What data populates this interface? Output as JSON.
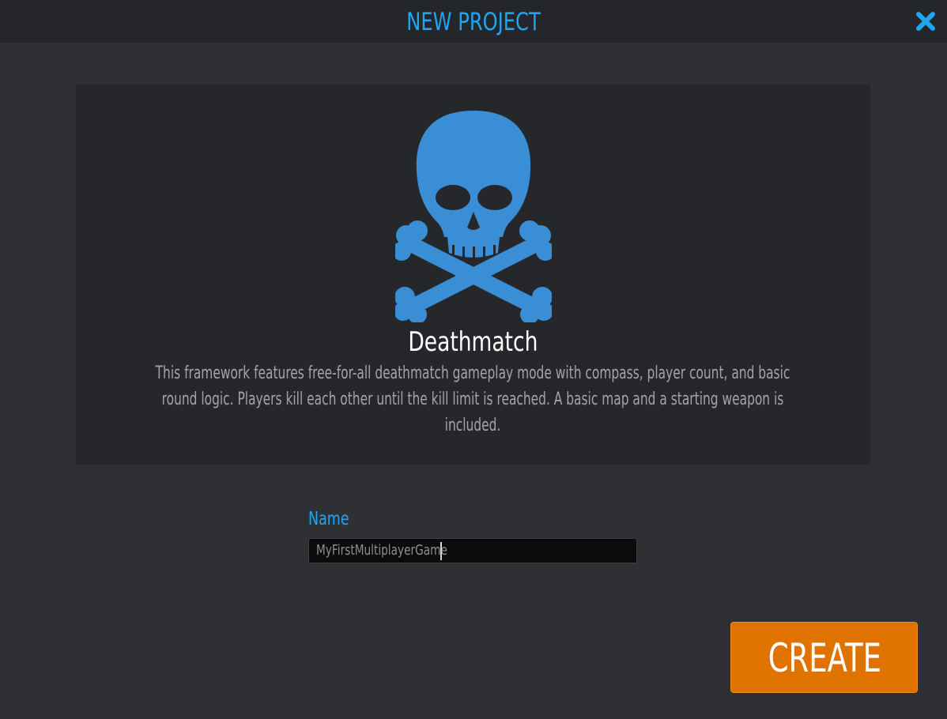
{
  "dialog": {
    "title": "NEW PROJECT",
    "close_icon": "close-icon"
  },
  "template": {
    "icon": "skull-crossbones-icon",
    "icon_color": "#3a8ed6",
    "name": "Deathmatch",
    "description": "This framework features free-for-all deathmatch gameplay mode with compass, player count, and basic round logic. Players kill each other until the kill limit is reached. A basic map and a starting weapon is included."
  },
  "form": {
    "name_label": "Name",
    "name_value": "MyFirstMultiplayerGame"
  },
  "actions": {
    "create_label": "CREATE"
  },
  "colors": {
    "accent": "#1ea7f0",
    "button": "#e07200",
    "background": "#2f3034",
    "card": "#26272b"
  }
}
